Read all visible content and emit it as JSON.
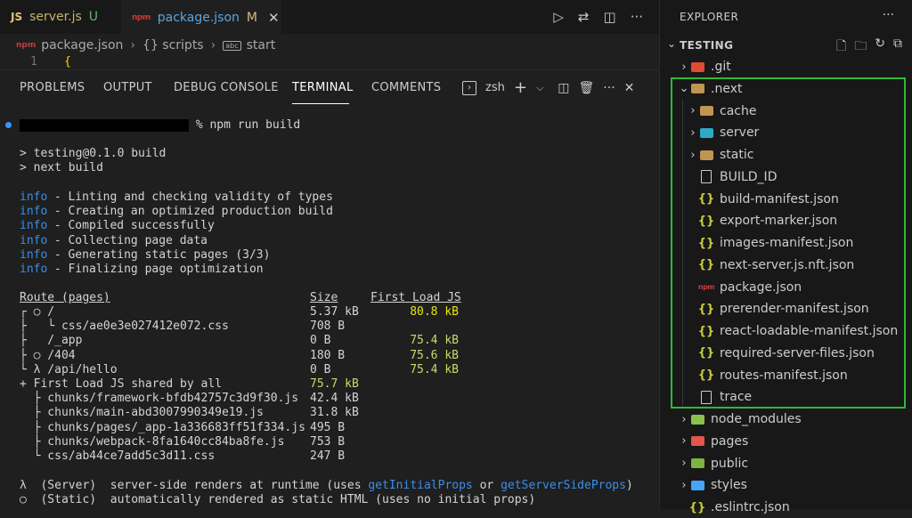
{
  "tabs": [
    {
      "icon": "JS",
      "name": "server.js",
      "status": "U"
    },
    {
      "icon": "npm",
      "name": "package.json",
      "status": "M"
    }
  ],
  "breadcrumb": {
    "file": "package.json",
    "parts": [
      "{} scripts",
      "start"
    ]
  },
  "editor": {
    "line_number": "1",
    "text": "{"
  },
  "panel": {
    "tabs": [
      "PROBLEMS",
      "OUTPUT",
      "DEBUG CONSOLE",
      "TERMINAL",
      "COMMENTS"
    ],
    "active_tab": "TERMINAL",
    "shell": "zsh"
  },
  "terminal": {
    "prompt_suffix": "% npm run build",
    "script_lines": [
      "> testing@0.1.0 build",
      "> next build"
    ],
    "info_tag": "info",
    "info_lines": [
      " - Linting and checking validity of types",
      " - Creating an optimized production build",
      " - Compiled successfully",
      " - Collecting page data",
      " - Generating static pages (3/3)",
      " - Finalizing page optimization"
    ],
    "table_header": {
      "route": "Route (pages)",
      "size": "Size",
      "first_load": "First Load JS"
    },
    "routes": [
      {
        "route": "┌ ○ /",
        "size": "5.37 kB",
        "first_load": "80.8 kB"
      },
      {
        "route": "├   └ css/ae0e3e027412e072.css",
        "size": "708 B",
        "first_load": ""
      },
      {
        "route": "├   /_app",
        "size": "0 B",
        "first_load": "75.4 kB"
      },
      {
        "route": "├ ○ /404",
        "size": "180 B",
        "first_load": "75.6 kB"
      },
      {
        "route": "└ λ /api/hello",
        "size": "0 B",
        "first_load": "75.4 kB"
      }
    ],
    "shared": {
      "label": "+ First Load JS shared by all",
      "size": "75.7 kB"
    },
    "chunks": [
      {
        "name": "  ├ chunks/framework-bfdb42757c3d9f30.js",
        "size": "42.4 kB"
      },
      {
        "name": "  ├ chunks/main-abd3007990349e19.js",
        "size": "31.8 kB"
      },
      {
        "name": "  ├ chunks/pages/_app-1a336683ff51f334.js",
        "size": "495 B"
      },
      {
        "name": "  ├ chunks/webpack-8fa1640cc84ba8fe.js",
        "size": "753 B"
      },
      {
        "name": "  └ css/ab44ce7add5c3d11.css",
        "size": "247 B"
      }
    ],
    "legend": [
      {
        "symbol": "λ",
        "kind": "(Server)",
        "text": "  server-side renders at runtime (uses ",
        "api1": "getInitialProps",
        "mid": " or ",
        "api2": "getServerSideProps",
        "end": ")"
      },
      {
        "symbol": "○",
        "kind": "(Static)",
        "text": "  automatically rendered as static HTML (uses no initial props)"
      }
    ]
  },
  "explorer": {
    "title": "EXPLORER",
    "project": "TESTING",
    "items": [
      {
        "name": ".git",
        "kind": "folder",
        "color": "#de4c36",
        "depth": 0,
        "expanded": false
      },
      {
        "name": ".next",
        "kind": "folder",
        "color": "#c09553",
        "depth": 0,
        "expanded": true
      },
      {
        "name": "cache",
        "kind": "folder",
        "color": "#c09553",
        "depth": 1,
        "expanded": false
      },
      {
        "name": "server",
        "kind": "folder",
        "color": "#2da9c4",
        "depth": 1,
        "expanded": false
      },
      {
        "name": "static",
        "kind": "folder",
        "color": "#c09553",
        "depth": 1,
        "expanded": false
      },
      {
        "name": "BUILD_ID",
        "kind": "file",
        "depth": 1
      },
      {
        "name": "build-manifest.json",
        "kind": "json",
        "depth": 1
      },
      {
        "name": "export-marker.json",
        "kind": "json",
        "depth": 1
      },
      {
        "name": "images-manifest.json",
        "kind": "json",
        "depth": 1
      },
      {
        "name": "next-server.js.nft.json",
        "kind": "json",
        "depth": 1
      },
      {
        "name": "package.json",
        "kind": "npm",
        "depth": 1
      },
      {
        "name": "prerender-manifest.json",
        "kind": "json",
        "depth": 1
      },
      {
        "name": "react-loadable-manifest.json",
        "kind": "json",
        "depth": 1
      },
      {
        "name": "required-server-files.json",
        "kind": "json",
        "depth": 1
      },
      {
        "name": "routes-manifest.json",
        "kind": "json",
        "depth": 1
      },
      {
        "name": "trace",
        "kind": "file",
        "depth": 1
      },
      {
        "name": "node_modules",
        "kind": "folder",
        "color": "#8bc34a",
        "depth": 0,
        "expanded": false
      },
      {
        "name": "pages",
        "kind": "folder",
        "color": "#e2574c",
        "depth": 0,
        "expanded": false
      },
      {
        "name": "public",
        "kind": "folder",
        "color": "#7cb342",
        "depth": 0,
        "expanded": false
      },
      {
        "name": "styles",
        "kind": "folder",
        "color": "#42a5f5",
        "depth": 0,
        "expanded": false
      },
      {
        "name": ".eslintrc.json",
        "kind": "json",
        "depth": 0
      }
    ]
  },
  "colors": {
    "highlight": "#2fb83c",
    "terminal_blue": "#3b8eea",
    "terminal_green": "#cdd86a"
  }
}
